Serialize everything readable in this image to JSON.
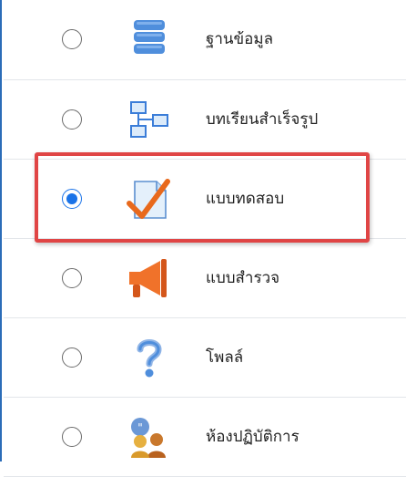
{
  "activity_chooser": {
    "items": [
      {
        "label": "ฐานข้อมูล",
        "icon": "database-icon",
        "selected": false
      },
      {
        "label": "บทเรียนสำเร็จรูป",
        "icon": "lesson-icon",
        "selected": false
      },
      {
        "label": "แบบทดสอบ",
        "icon": "quiz-icon",
        "selected": true
      },
      {
        "label": "แบบสำรวจ",
        "icon": "survey-megaphone-icon",
        "selected": false
      },
      {
        "label": "โพลล์",
        "icon": "poll-question-icon",
        "selected": false
      },
      {
        "label": "ห้องปฏิบัติการ",
        "icon": "workshop-people-icon",
        "selected": false
      }
    ]
  },
  "colors": {
    "accent": "#1a73e8",
    "highlight_border": "#e04545",
    "frame_border": "#2b6cb8"
  }
}
